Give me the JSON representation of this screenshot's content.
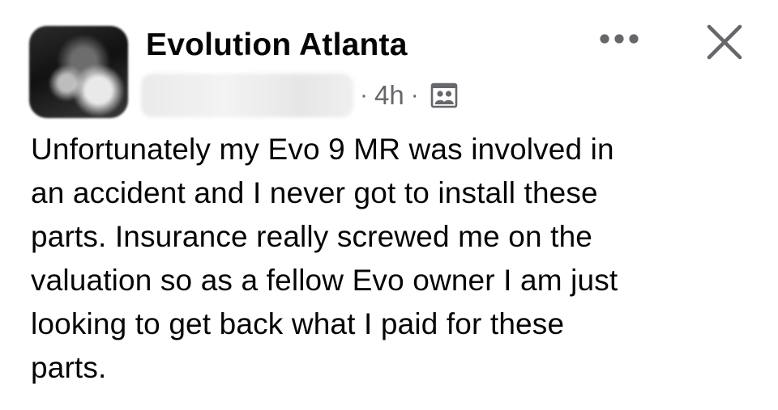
{
  "post": {
    "group_name": "Evolution Atlanta",
    "author_name": "Redacted member",
    "separator": "·",
    "timestamp": "4h",
    "audience_icon": "members-icon",
    "more_icon": "more-options-icon",
    "close_icon": "close-icon",
    "body": "Unfortunately my Evo 9 MR was involved in\nan accident and I never got to install these\nparts. Insurance really screwed me on the\nvaluation so as a fellow Evo owner I am just\nlooking to get back what I paid for these\nparts."
  },
  "colors": {
    "text": "#050505",
    "secondary_text": "#65676b",
    "icon": "#65676b"
  }
}
